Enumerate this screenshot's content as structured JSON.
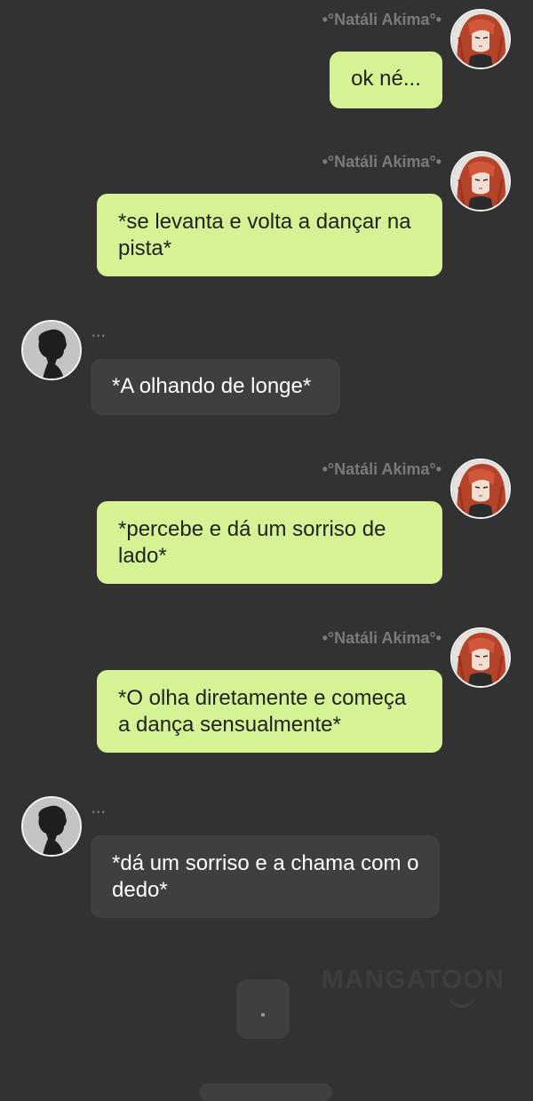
{
  "chat": {
    "messages": [
      {
        "sender": "•°Natáli Akima°•",
        "side": "right",
        "text": "ok né..."
      },
      {
        "sender": "•°Natáli Akima°•",
        "side": "right",
        "text": "*se levanta e volta a dançar na pista*"
      },
      {
        "sender": "...",
        "side": "left",
        "text": "*A olhando de longe*"
      },
      {
        "sender": "•°Natáli Akima°•",
        "side": "right",
        "text": "*percebe e dá um sorriso de lado*"
      },
      {
        "sender": "•°Natáli Akima°•",
        "side": "right",
        "text": "*O olha diretamente e começa a dança sensualmente*"
      },
      {
        "sender": "...",
        "side": "left",
        "text": "*dá um sorriso e a chama com o dedo*"
      }
    ]
  },
  "watermark": {
    "text": "MANGATOON"
  },
  "colors": {
    "background": "#323232",
    "right_bubble": "#d5f294",
    "left_bubble": "#3f3f3f",
    "sender_name": "#7a7a7a"
  },
  "icons": {
    "right_avatar": "red-haired-girl-avatar",
    "left_avatar": "silhouette-avatar"
  }
}
